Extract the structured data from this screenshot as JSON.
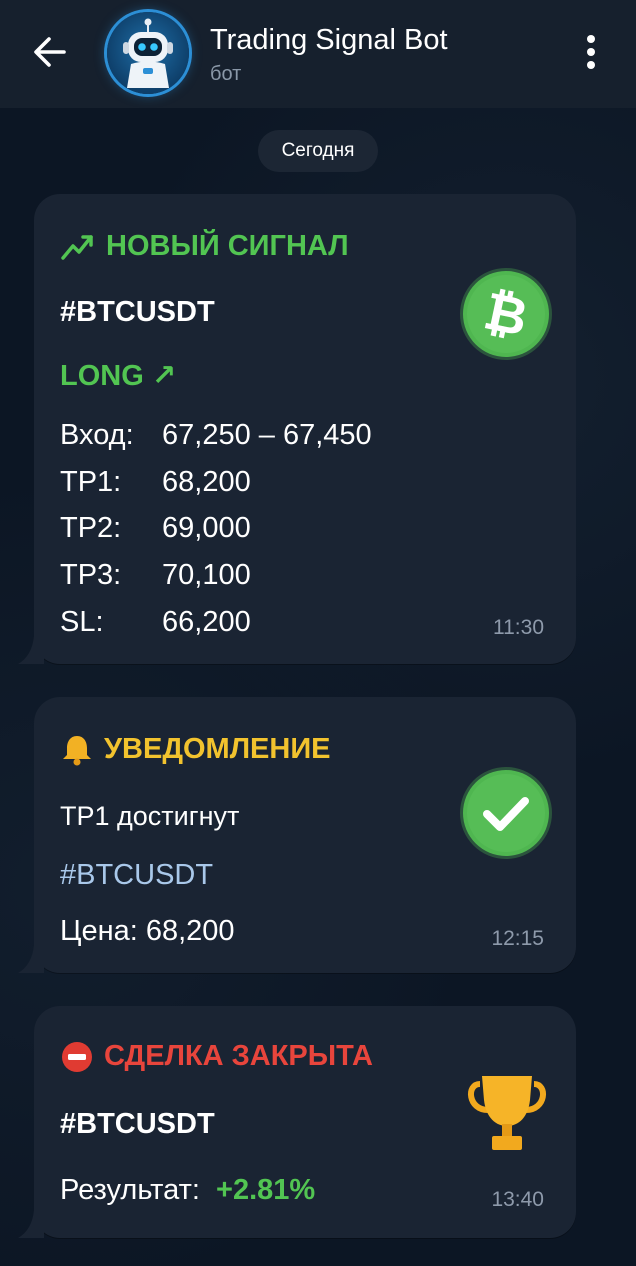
{
  "header": {
    "title": "Trading Signal Bot",
    "subtitle": "бот"
  },
  "date_label": "Сегодня",
  "colors": {
    "accent_green": "#52c552",
    "accent_yellow": "#f2c32e",
    "accent_red": "#e8453c",
    "bubble_bg": "#1a2433"
  },
  "messages": {
    "signal": {
      "title": "НОВЫЙ СИГНАЛ",
      "title_icon": "chart-increasing-icon",
      "pair": "#BTCUSDT",
      "direction": "LONG ↗",
      "side_icon": "bitcoin-icon",
      "rows": [
        {
          "label": "Вход:",
          "value": "67,250 – 67,450"
        },
        {
          "label": "TP1:",
          "value": "68,200"
        },
        {
          "label": "TP2:",
          "value": "69,000"
        },
        {
          "label": "TP3:",
          "value": "70,100"
        },
        {
          "label": "SL:",
          "value": "66,200"
        }
      ],
      "time": "11:30"
    },
    "notice": {
      "title": "УВЕДОМЛЕНИЕ",
      "title_icon": "bell-icon",
      "line1": "TP1 достигнут",
      "pair": "#BTCUSDT",
      "price": "Цена: 68,200",
      "side_icon": "check-mark-icon",
      "time": "12:15"
    },
    "closed": {
      "title": "СДЕЛКА ЗАКРЫТА",
      "title_icon": "no-entry-icon",
      "pair": "#BTCUSDT",
      "result_label": "Результат:",
      "result_value": "+2.81%",
      "side_icon": "trophy-icon",
      "time": "13:40"
    }
  }
}
